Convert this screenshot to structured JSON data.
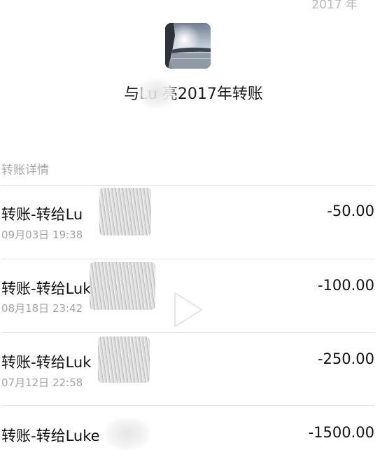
{
  "header": {
    "year_fragment": "2017 年",
    "avatar_icon": "landscape-photo-avatar",
    "title": "与Lu    亮2017年转账"
  },
  "section": {
    "label": "转账详情"
  },
  "transactions": [
    {
      "name": "转账-转给Lu",
      "time": "09月03日 19:38",
      "amount": "-50.00"
    },
    {
      "name": "转账-转给Luk",
      "time": "08月18日 23:42",
      "amount": "-100.00"
    },
    {
      "name": "转账-转给Luk",
      "time": "07月12日 22:58",
      "amount": "-250.00"
    },
    {
      "name": "转账-转给Luke",
      "time": "",
      "amount": "-1500.00"
    }
  ],
  "overlay": {
    "play_icon": "play-icon"
  }
}
